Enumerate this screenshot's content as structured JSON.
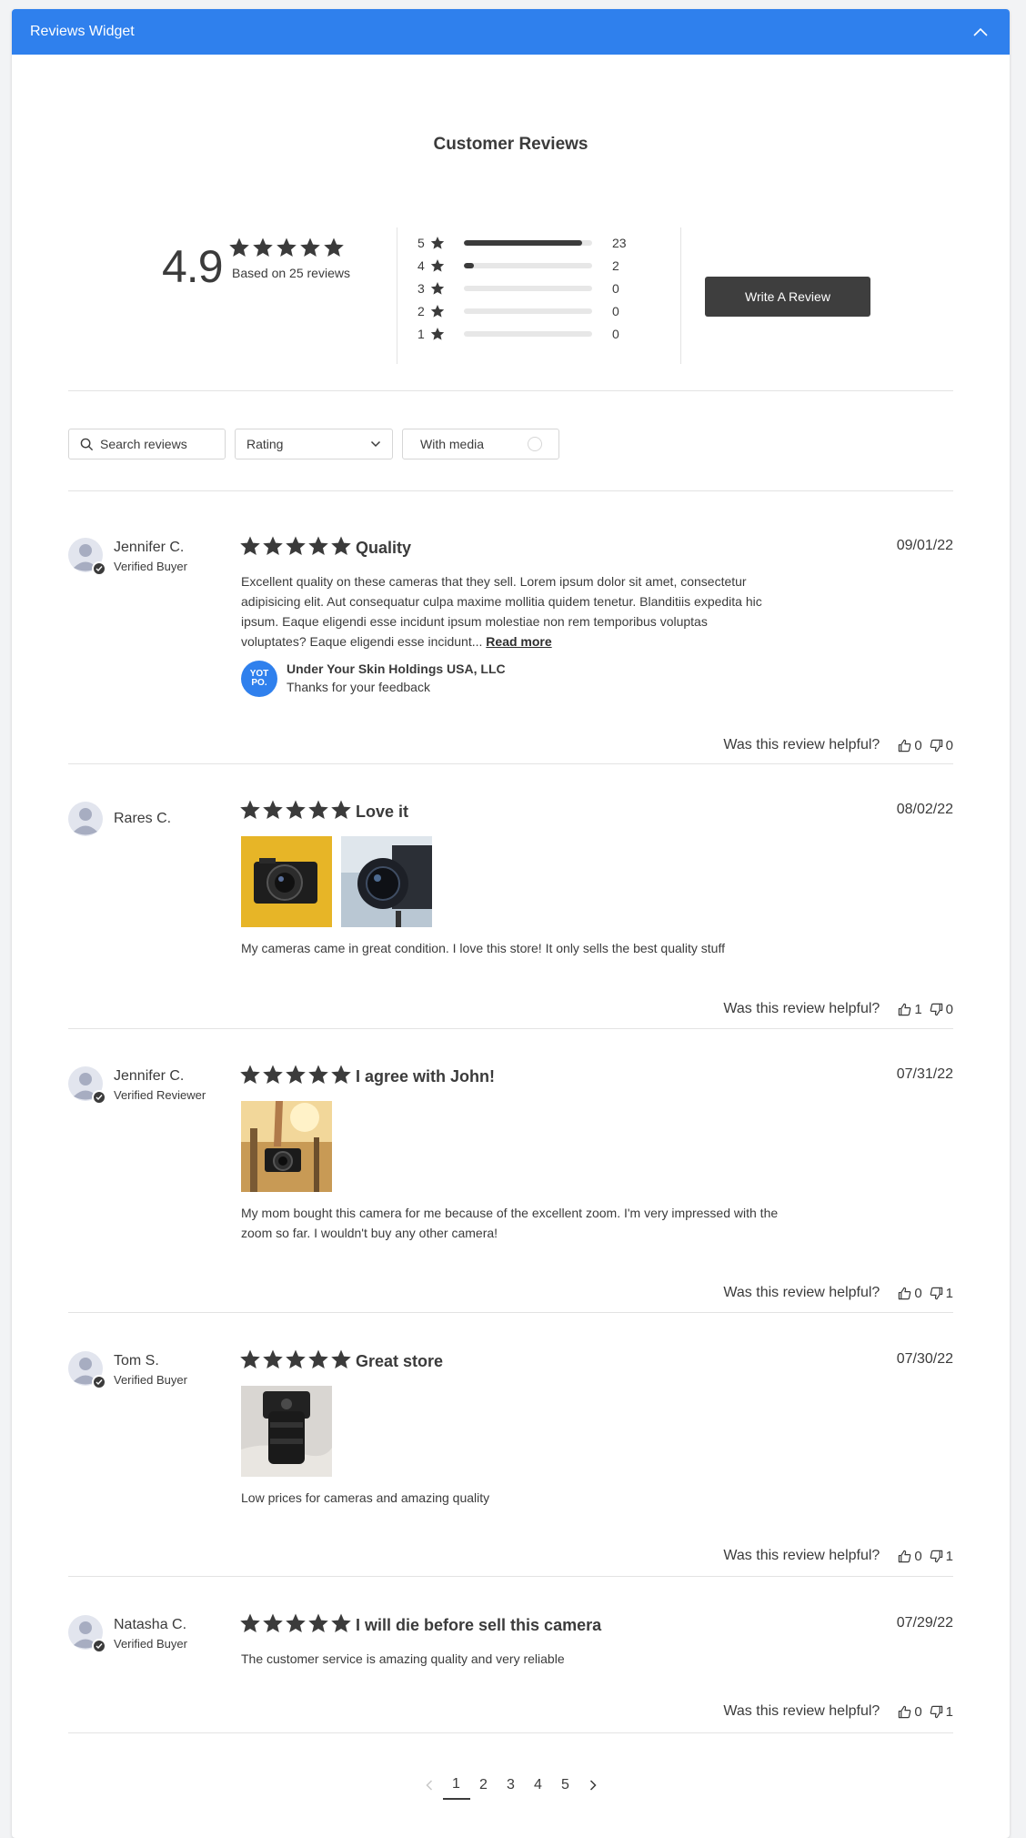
{
  "widget": {
    "title": "Reviews Widget"
  },
  "header": {
    "title": "Customer Reviews"
  },
  "summary": {
    "average": "4.9",
    "average_rating": 4.9,
    "based_on": "Based on 25 reviews",
    "distribution": [
      {
        "stars": "5",
        "count": "23",
        "fraction": 0.92
      },
      {
        "stars": "4",
        "count": "2",
        "fraction": 0.08
      },
      {
        "stars": "3",
        "count": "0",
        "fraction": 0
      },
      {
        "stars": "2",
        "count": "0",
        "fraction": 0
      },
      {
        "stars": "1",
        "count": "0",
        "fraction": 0
      }
    ],
    "write_review_label": "Write A Review"
  },
  "filters": {
    "search_placeholder": "Search reviews",
    "rating_label": "Rating",
    "media_label": "With media"
  },
  "reviews": [
    {
      "name": "Jennifer C.",
      "badge": "Verified Buyer",
      "rating": 5,
      "title": "Quality",
      "date": "09/01/22",
      "body": "Excellent quality on these cameras that they sell. Lorem ipsum dolor sit amet, consectetur adipisicing elit. Aut consequatur culpa maxime mollitia quidem tenetur. Blanditiis expedita hic ipsum. Eaque eligendi esse incidunt ipsum molestiae non rem temporibus voluptas voluptates? Eaque eligendi esse incidunt...",
      "read_more": "Read more",
      "reply": {
        "logo": "YOT PO.",
        "name": "Under Your Skin Holdings USA, LLC",
        "message": "Thanks for your feedback"
      },
      "helpful_label": "Was this review helpful?",
      "up": "0",
      "down": "0"
    },
    {
      "name": "Rares C.",
      "rating": 5,
      "title": "Love it",
      "date": "08/02/22",
      "body": "My cameras came in great condition. I love this store! It only sells the best quality stuff",
      "helpful_label": "Was this review helpful?",
      "up": "1",
      "down": "0"
    },
    {
      "name": "Jennifer C.",
      "badge": "Verified Reviewer",
      "rating": 5,
      "title": "I agree with John!",
      "date": "07/31/22",
      "body": "My mom bought this camera for me because of the excellent zoom. I'm very impressed with the zoom so far. I wouldn't buy any other camera!",
      "helpful_label": "Was this review helpful?",
      "up": "0",
      "down": "1"
    },
    {
      "name": "Tom S.",
      "badge": "Verified Buyer",
      "rating": 5,
      "title": "Great store",
      "date": "07/30/22",
      "body": "Low prices for cameras and amazing quality",
      "helpful_label": "Was this review helpful?",
      "up": "0",
      "down": "1"
    },
    {
      "name": "Natasha C.",
      "badge": "Verified Buyer",
      "rating": 5,
      "title": "I will die before sell this camera",
      "date": "07/29/22",
      "body": "The customer service is amazing quality and very reliable",
      "helpful_label": "Was this review helpful?",
      "up": "0",
      "down": "1"
    }
  ],
  "pagination": {
    "pages": [
      "1",
      "2",
      "3",
      "4",
      "5"
    ],
    "current": "1"
  },
  "colors": {
    "accent": "#2f80ed",
    "dark": "#3e3e3e"
  }
}
